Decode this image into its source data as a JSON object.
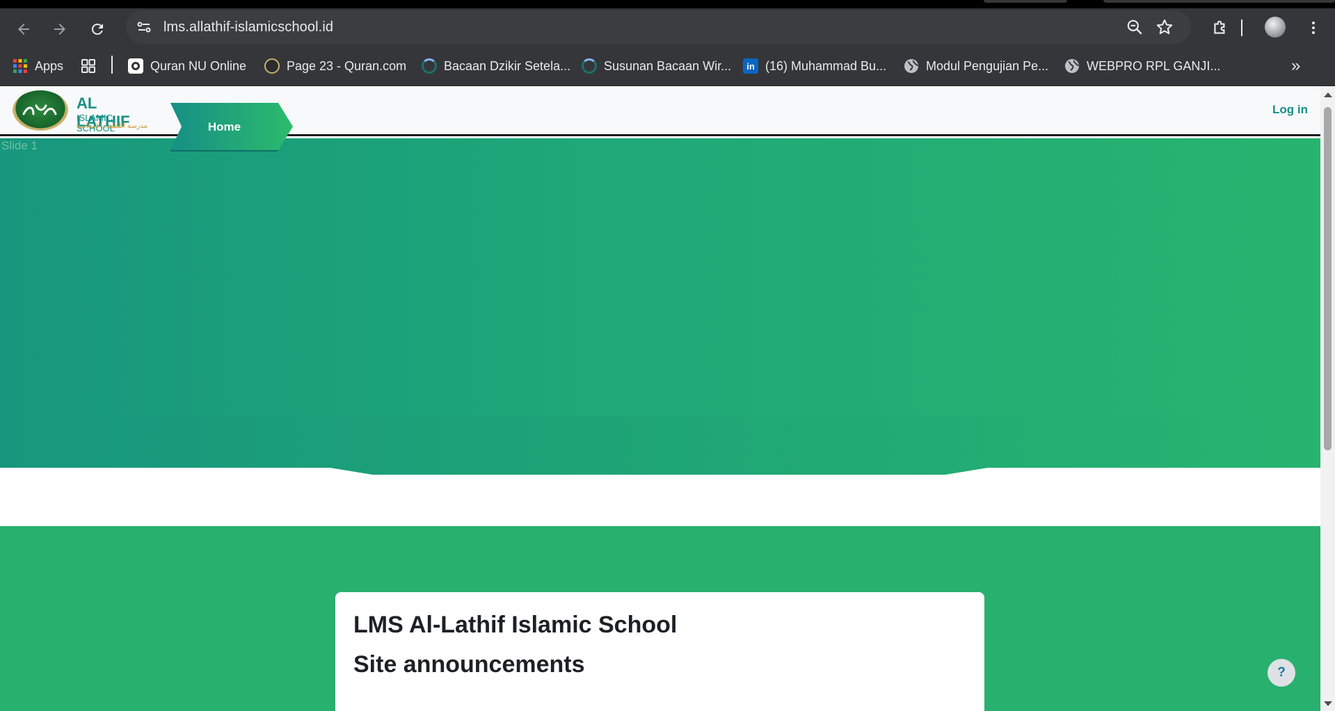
{
  "browser": {
    "url": "lms.allathif-islamicschool.id",
    "bookmarks": [
      {
        "label": "Apps",
        "icon": "apps-grid-icon"
      },
      {
        "label": "",
        "icon": "tab-groups-icon"
      },
      {
        "label": "Quran NU Online",
        "icon": "quran-nu-icon"
      },
      {
        "label": "Page 23 - Quran.com",
        "icon": "quran-com-icon"
      },
      {
        "label": "Bacaan Dzikir Setela...",
        "icon": "loading-icon"
      },
      {
        "label": "Susunan Bacaan Wir...",
        "icon": "loading-icon"
      },
      {
        "label": "(16) Muhammad Bu...",
        "icon": "linkedin-icon"
      },
      {
        "label": "Modul Pengujian Pe...",
        "icon": "globe-icon"
      },
      {
        "label": "WEBPRO RPL GANJI...",
        "icon": "globe-icon"
      }
    ],
    "more_bookmarks": "»"
  },
  "site": {
    "brand_line1": "AL LATHIF",
    "brand_line2": "ISLAMIC SCHOOL",
    "brand_line3": "مدرسة اللطيف الإسلامية",
    "nav_home": "Home",
    "login": "Log in",
    "slide_alt": "Slide 1",
    "card_title": "LMS Al-Lathif Islamic School",
    "card_subtitle": "Site announcements",
    "help": "?"
  },
  "colors": {
    "accent": "#168f86",
    "hero_left": "#17977d",
    "hero_right": "#27b46f",
    "section": "#28b06f"
  }
}
